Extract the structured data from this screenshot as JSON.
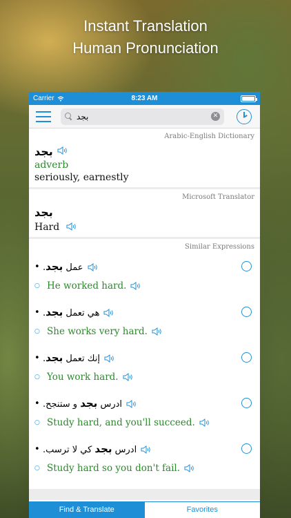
{
  "headline": {
    "line1": "Instant Translation",
    "line2": "Human Pronunciation"
  },
  "status": {
    "carrier": "Carrier",
    "time": "8:23 AM"
  },
  "search": {
    "value": "بجد"
  },
  "dictionary_card": {
    "source": "Arabic-English Dictionary",
    "word": "بجد",
    "part_of_speech": "adverb",
    "meaning": "seriously, earnestly"
  },
  "translator_card": {
    "source": "Microsoft Translator",
    "word": "بجد",
    "translation": "Hard"
  },
  "similar": {
    "title": "Similar Expressions",
    "items": [
      {
        "ar_before": "عمل ",
        "ar_bold": "بجد",
        "ar_after": ".",
        "en": "He worked hard."
      },
      {
        "ar_before": "هي تعمل ",
        "ar_bold": "بجد",
        "ar_after": ".",
        "en": "She works very hard."
      },
      {
        "ar_before": "إنك تعمل ",
        "ar_bold": "بجد",
        "ar_after": ".",
        "en": "You work hard."
      },
      {
        "ar_before": "ادرس ",
        "ar_bold": "بجد",
        "ar_after": " و ستنجح.",
        "en": "Study hard, and you'll succeed."
      },
      {
        "ar_before": "ادرس ",
        "ar_bold": "بجد",
        "ar_after": " كي لا ترسب.",
        "en": "Study hard so you don't fail."
      }
    ]
  },
  "tabs": {
    "find_translate": "Find & Translate",
    "favorites": "Favorites"
  },
  "colors": {
    "accent": "#1e8fd6",
    "part_of_speech": "#2a8a2a"
  }
}
